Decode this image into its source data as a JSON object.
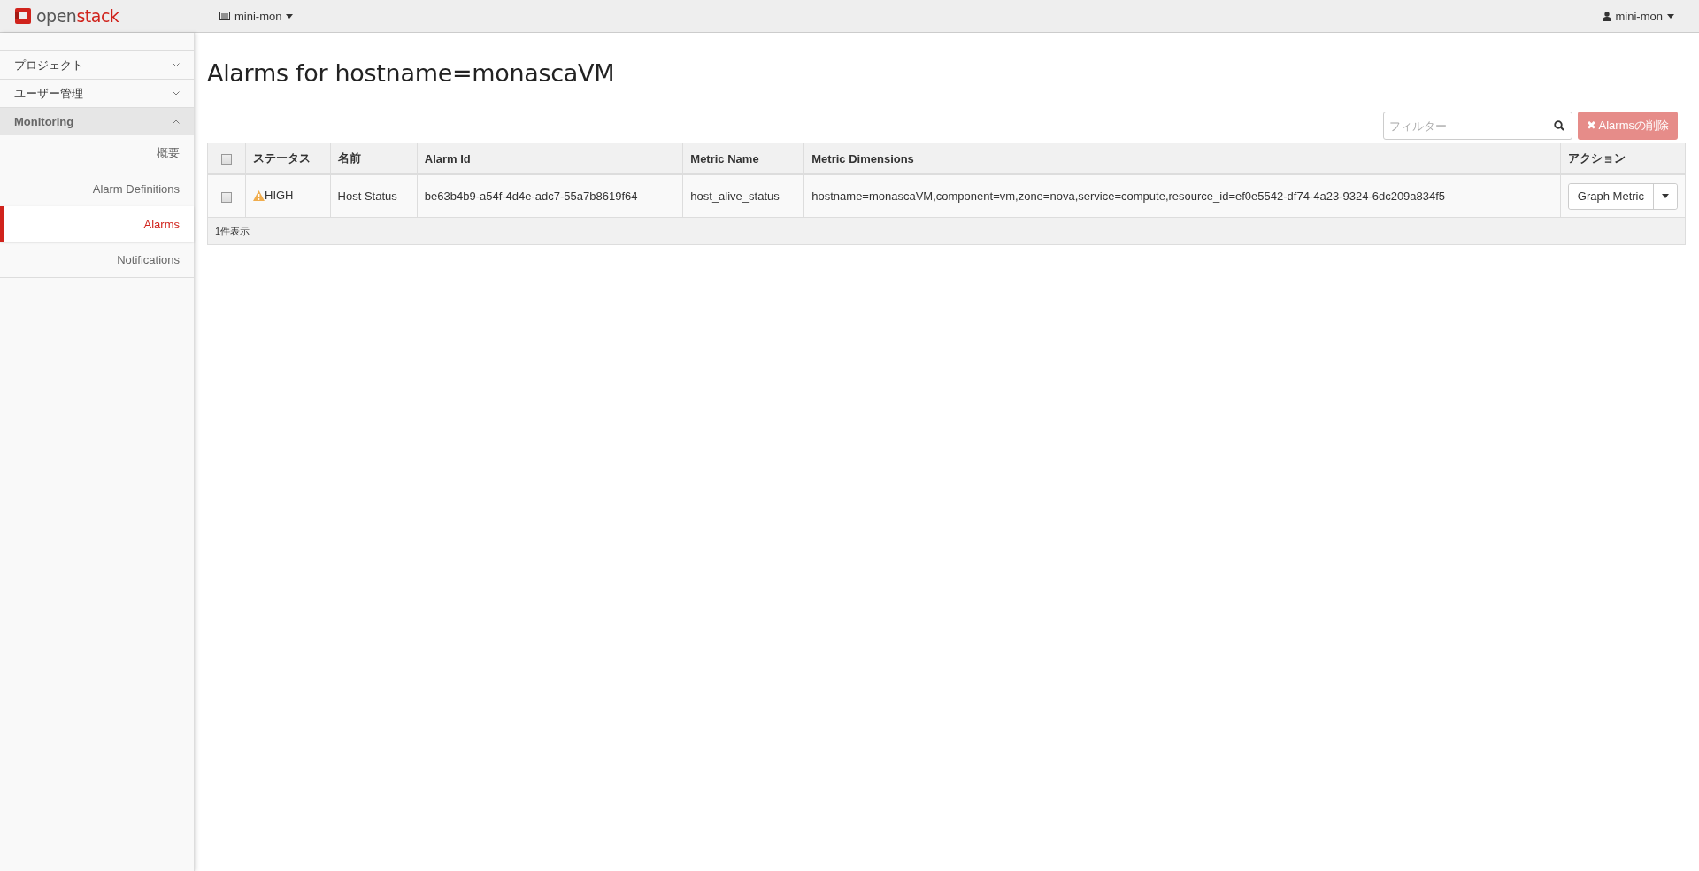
{
  "topbar": {
    "logo": {
      "part_1": "open",
      "part_2": "stack"
    },
    "project_menu": "mini-mon",
    "user_menu": "mini-mon"
  },
  "sidebar": {
    "sections": [
      {
        "label": "プロジェクト",
        "expanded": false
      },
      {
        "label": "ユーザー管理",
        "expanded": false
      },
      {
        "label": "Monitoring",
        "expanded": true,
        "items": [
          {
            "label": "概要",
            "selected": false
          },
          {
            "label": "Alarm Definitions",
            "selected": false
          },
          {
            "label": "Alarms",
            "selected": true
          },
          {
            "label": "Notifications",
            "selected": false
          }
        ]
      }
    ]
  },
  "page_title": "Alarms for hostname=monascaVM",
  "filter": {
    "placeholder": "フィルター"
  },
  "delete_button": {
    "icon": "✖",
    "label": "Alarmsの削除",
    "disabled": true
  },
  "table": {
    "columns": [
      "ステータス",
      "名前",
      "Alarm Id",
      "Metric Name",
      "Metric Dimensions",
      "アクション"
    ],
    "select_all_checked": false,
    "rows": [
      {
        "checked": false,
        "status": "HIGH",
        "kind": "warning",
        "name": "Host Status",
        "alarm_id": "be63b4b9-a54f-4d4e-adc7-55a7b8619f64",
        "metric_name": "host_alive_status",
        "metric_dimensions": "hostname=monascaVM,component=vm,zone=nova,service=compute,resource_id=ef0e5542-df74-4a23-9324-6dc209a834f5",
        "action": "Graph Metric"
      }
    ],
    "footer": "1件表示"
  }
}
